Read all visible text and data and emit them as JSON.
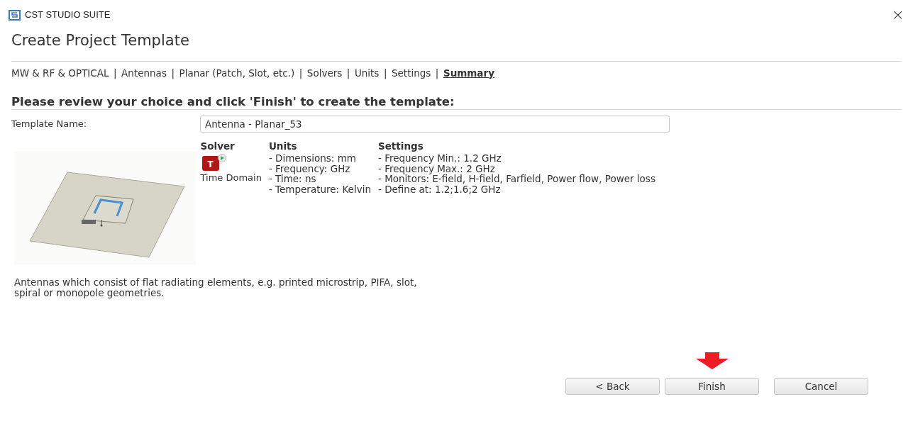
{
  "window": {
    "title": "CST STUDIO SUITE",
    "close": "×"
  },
  "heading": "Create Project Template",
  "breadcrumb": {
    "separator": "|",
    "items": [
      {
        "label": "MW & RF & OPTICAL",
        "selected": false
      },
      {
        "label": "Antennas",
        "selected": false
      },
      {
        "label": "Planar (Patch, Slot, etc.)",
        "selected": false
      },
      {
        "label": "Solvers",
        "selected": false
      },
      {
        "label": "Units",
        "selected": false
      },
      {
        "label": "Settings",
        "selected": false
      },
      {
        "label": "Summary",
        "selected": true
      }
    ]
  },
  "instruction": "Please review your choice and click 'Finish' to create the template:",
  "template_name": {
    "label": "Template Name:",
    "value": "Antenna - Planar_53"
  },
  "solver": {
    "heading": "Solver",
    "icon_letter": "T",
    "name": "Time Domain"
  },
  "units": {
    "heading": "Units",
    "items": [
      "- Dimensions: mm",
      "- Frequency: GHz",
      "- Time: ns",
      "- Temperature: Kelvin"
    ]
  },
  "settings": {
    "heading": "Settings",
    "items": [
      "- Frequency Min.: 1.2 GHz",
      "- Frequency Max.: 2 GHz",
      "- Monitors: E-field, H-field, Farfield, Power flow, Power loss",
      "- Define at: 1.2;1.6;2 GHz"
    ]
  },
  "description": "Antennas which consist of flat radiating elements, e.g. printed microstrip, PIFA, slot, spiral or monopole geometries.",
  "buttons": [
    {
      "label": "< Back",
      "highlighted": false
    },
    {
      "label": "Finish",
      "highlighted": true
    },
    {
      "label": "Cancel",
      "highlighted": false
    }
  ]
}
